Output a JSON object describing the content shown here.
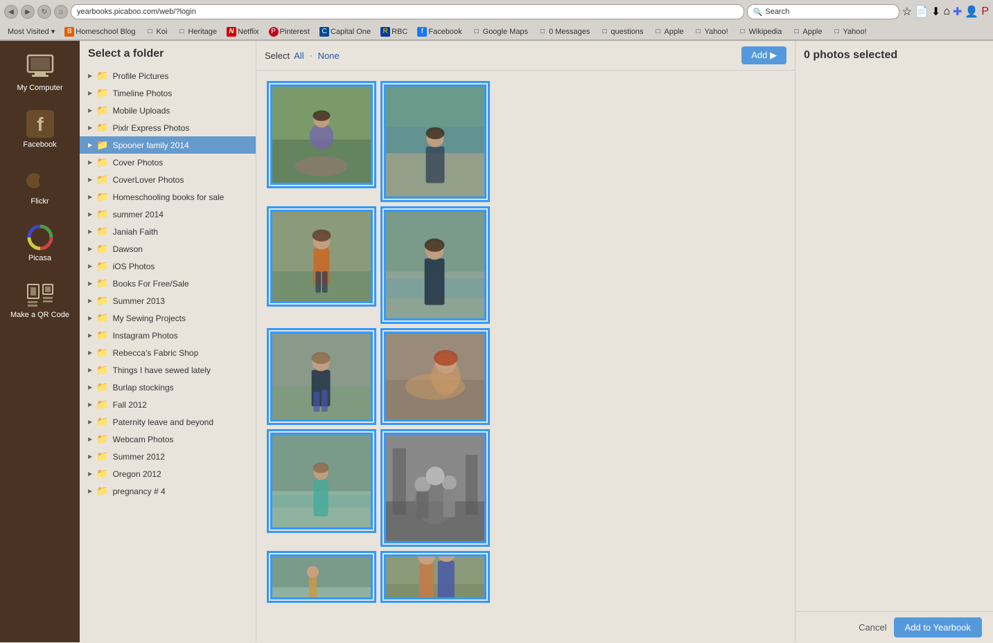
{
  "browser": {
    "url": "yearbooks.picaboo.com/web/?login",
    "search_placeholder": "Search",
    "search_value": "Search",
    "nav_buttons": [
      "back",
      "forward",
      "reload",
      "home"
    ]
  },
  "bookmarks": [
    {
      "label": "Most Visited",
      "icon": "▾",
      "type": "dropdown"
    },
    {
      "label": "Homeschool Blog",
      "icon": "B",
      "type": "blogger"
    },
    {
      "label": "Koi",
      "icon": "□",
      "type": "folder"
    },
    {
      "label": "Heritage",
      "icon": "□",
      "type": "folder"
    },
    {
      "label": "Netflix",
      "icon": "N",
      "type": "netflix"
    },
    {
      "label": "Pinterest",
      "icon": "P",
      "type": "pinterest"
    },
    {
      "label": "Capital One",
      "icon": "C",
      "type": "capital"
    },
    {
      "label": "RBC",
      "icon": "R",
      "type": "rbc"
    },
    {
      "label": "Facebook",
      "icon": "f",
      "type": "facebook"
    },
    {
      "label": "Google Maps",
      "icon": "□",
      "type": "folder"
    },
    {
      "label": "0 Messages",
      "icon": "□",
      "type": "folder"
    },
    {
      "label": "questions",
      "icon": "□",
      "type": "folder"
    },
    {
      "label": "Apple",
      "icon": "□",
      "type": "folder"
    },
    {
      "label": "Yahoo!",
      "icon": "□",
      "type": "folder"
    },
    {
      "label": "Wikipedia",
      "icon": "□",
      "type": "folder"
    },
    {
      "label": "Apple",
      "icon": "□",
      "type": "folder"
    },
    {
      "label": "Yahoo!",
      "icon": "□",
      "type": "folder"
    }
  ],
  "sidebar": {
    "items": [
      {
        "id": "my-computer",
        "label": "My Computer",
        "icon": "computer"
      },
      {
        "id": "facebook",
        "label": "Facebook",
        "icon": "facebook"
      },
      {
        "id": "flickr",
        "label": "Flickr",
        "icon": "flickr"
      },
      {
        "id": "picasa",
        "label": "Picasa",
        "icon": "picasa"
      },
      {
        "id": "qr-code",
        "label": "Make a QR Code",
        "icon": "qrcode"
      }
    ]
  },
  "folder_panel": {
    "title": "Select a folder",
    "folders": [
      {
        "id": "profile",
        "label": "Profile Pictures",
        "selected": false
      },
      {
        "id": "timeline",
        "label": "Timeline Photos",
        "selected": false
      },
      {
        "id": "mobile",
        "label": "Mobile Uploads",
        "selected": false
      },
      {
        "id": "pixlr",
        "label": "Pixlr Express Photos",
        "selected": false
      },
      {
        "id": "spooner",
        "label": "Spooner family 2014",
        "selected": true
      },
      {
        "id": "cover",
        "label": "Cover Photos",
        "selected": false
      },
      {
        "id": "coverlover",
        "label": "CoverLover Photos",
        "selected": false
      },
      {
        "id": "homeschool",
        "label": "Homeschooling books for sale",
        "selected": false
      },
      {
        "id": "summer2014",
        "label": "summer 2014",
        "selected": false
      },
      {
        "id": "janiah",
        "label": "Janiah Faith",
        "selected": false
      },
      {
        "id": "dawson",
        "label": "Dawson",
        "selected": false
      },
      {
        "id": "ios",
        "label": "iOS Photos",
        "selected": false
      },
      {
        "id": "books",
        "label": "Books For Free/Sale",
        "selected": false
      },
      {
        "id": "summer2013",
        "label": "Summer 2013",
        "selected": false
      },
      {
        "id": "sewing",
        "label": "My Sewing Projects",
        "selected": false
      },
      {
        "id": "instagram",
        "label": "Instagram Photos",
        "selected": false
      },
      {
        "id": "rebecca",
        "label": "Rebecca's Fabric Shop",
        "selected": false
      },
      {
        "id": "things",
        "label": "Things I have sewed lately",
        "selected": false
      },
      {
        "id": "burlap",
        "label": "Burlap stockings",
        "selected": false
      },
      {
        "id": "fall2012",
        "label": "Fall 2012",
        "selected": false
      },
      {
        "id": "paternity",
        "label": "Paternity leave and beyond",
        "selected": false
      },
      {
        "id": "webcam",
        "label": "Webcam Photos",
        "selected": false
      },
      {
        "id": "summer2012",
        "label": "Summer 2012",
        "selected": false
      },
      {
        "id": "oregon",
        "label": "Oregon 2012",
        "selected": false
      },
      {
        "id": "pregnancy",
        "label": "pregnancy # 4",
        "selected": false
      }
    ]
  },
  "photo_grid": {
    "select_label": "Select",
    "all_label": "All",
    "none_label": "None",
    "add_button": "Add ▶",
    "photos": [
      {
        "id": "p1",
        "selected": true,
        "color": "photo-p1",
        "tall": false,
        "position": "col1"
      },
      {
        "id": "p2",
        "selected": true,
        "color": "photo-p2",
        "tall": true,
        "position": "col2"
      },
      {
        "id": "p3",
        "selected": true,
        "color": "photo-p3",
        "tall": false,
        "position": "col1"
      },
      {
        "id": "p4",
        "selected": true,
        "color": "photo-p4",
        "tall": true,
        "position": "col2"
      },
      {
        "id": "p5",
        "selected": true,
        "color": "photo-p5",
        "tall": false,
        "position": "col1"
      },
      {
        "id": "p6",
        "selected": true,
        "color": "photo-p6",
        "tall": false,
        "position": "col2"
      },
      {
        "id": "p7",
        "selected": true,
        "color": "photo-p7",
        "tall": false,
        "position": "col1"
      },
      {
        "id": "p8",
        "selected": true,
        "color": "photo-p8",
        "tall": true,
        "position": "col2"
      },
      {
        "id": "p9",
        "selected": true,
        "color": "photo-p9",
        "tall": false,
        "position": "col1"
      },
      {
        "id": "p10",
        "selected": true,
        "color": "photo-p10",
        "tall": false,
        "position": "col2"
      }
    ]
  },
  "right_panel": {
    "selected_count": "0 photos selected"
  },
  "bottom_bar": {
    "cancel_label": "Cancel",
    "add_yearbook_label": "Add to Yearbook"
  }
}
